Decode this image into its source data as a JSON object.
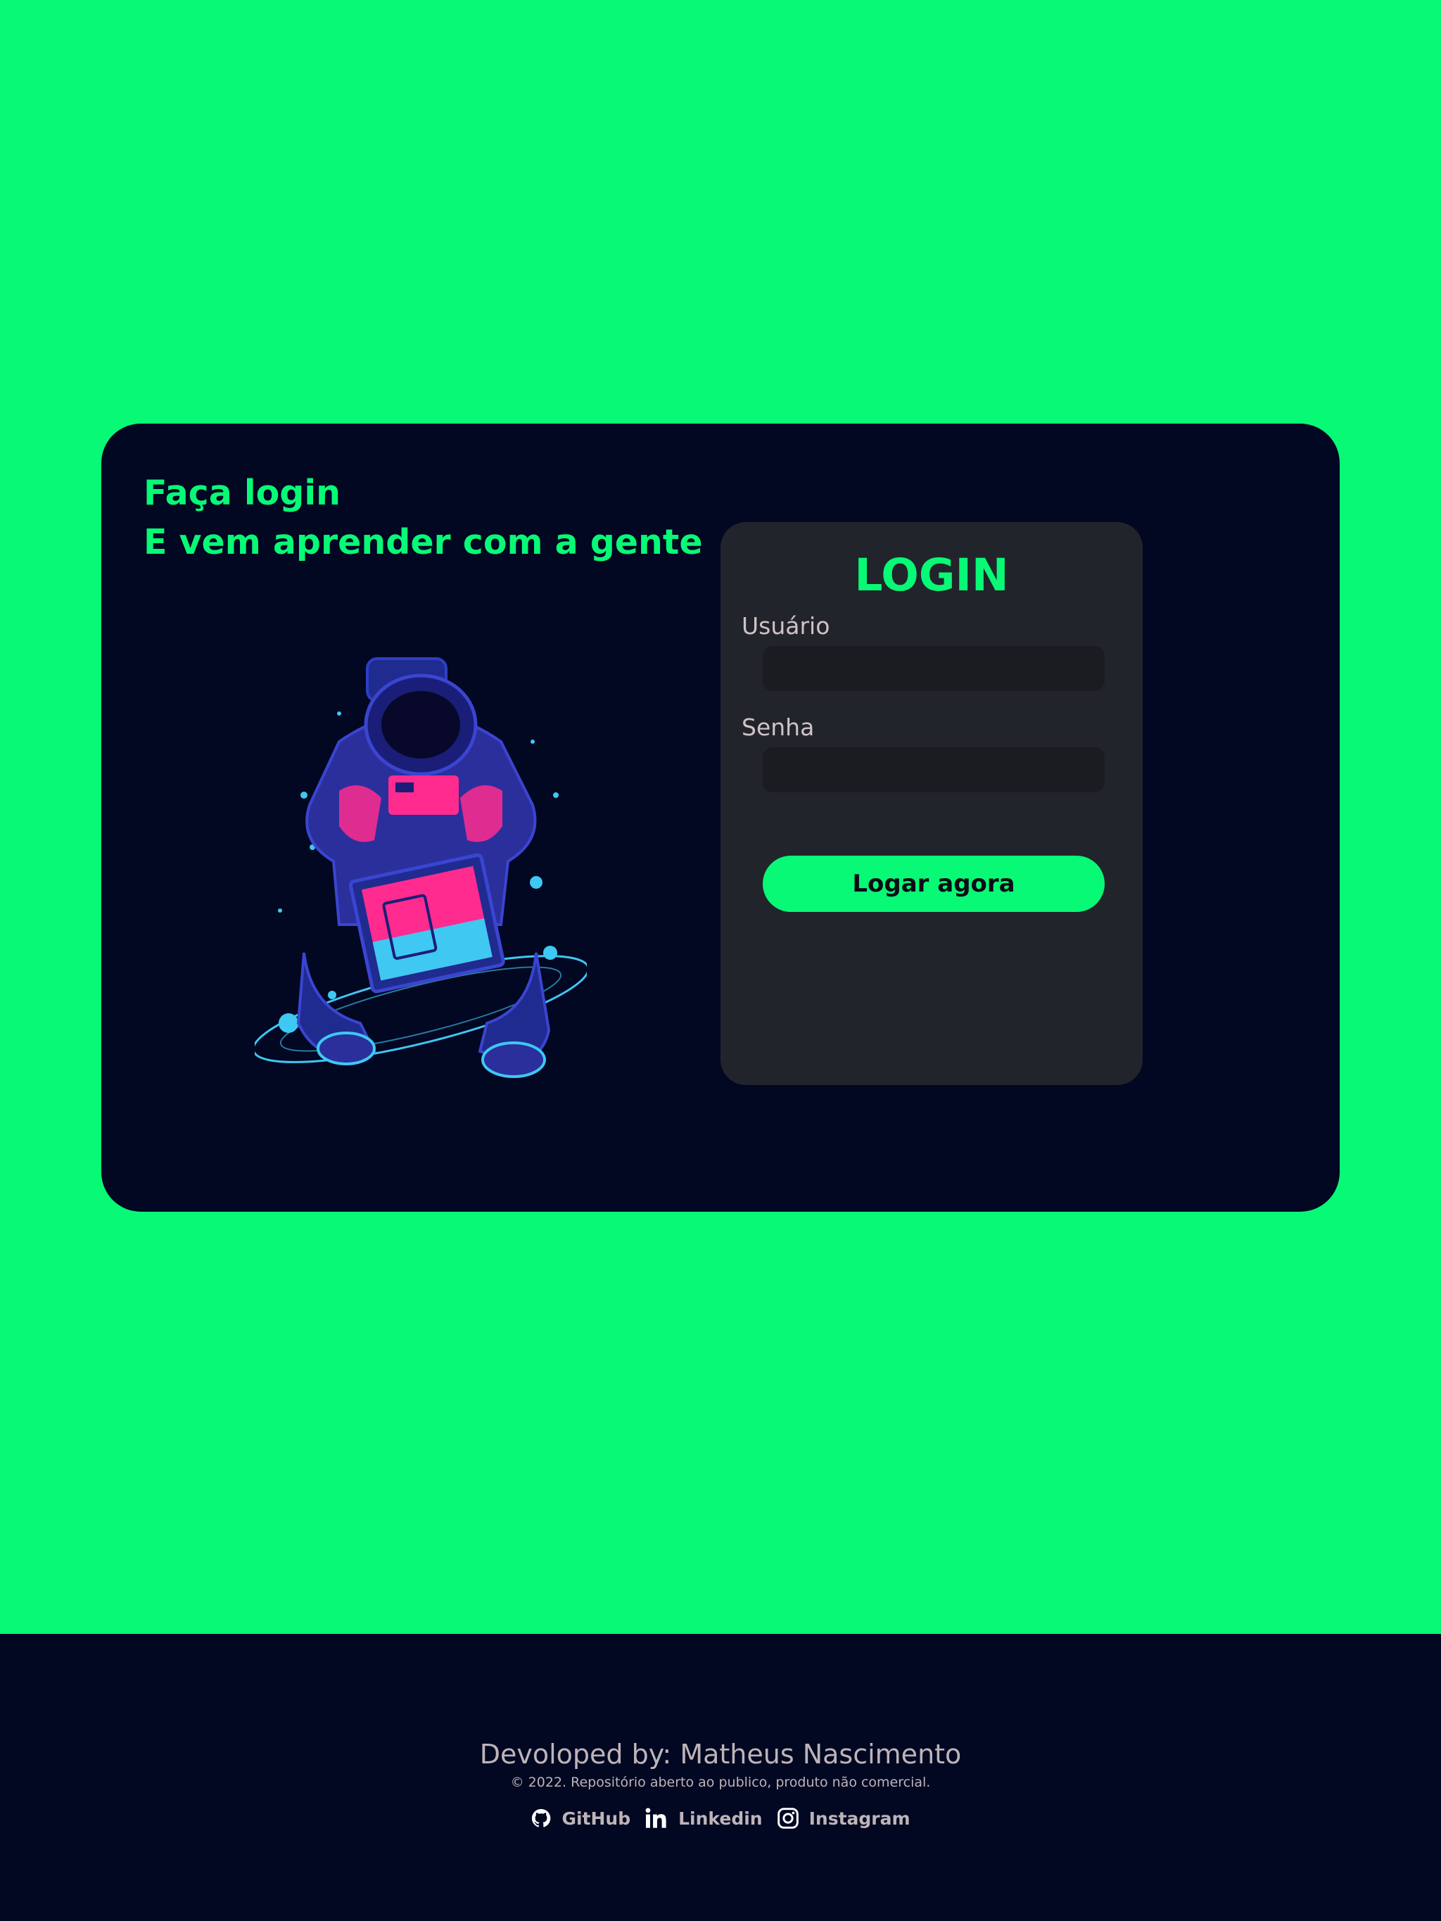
{
  "hero": {
    "line1": "Faça login",
    "line2": "E vem aprender com a gente",
    "illustration": "astronaut-with-tablet"
  },
  "login": {
    "title": "LOGIN",
    "username_label": "Usuário",
    "username_value": "",
    "password_label": "Senha",
    "password_value": "",
    "submit_label": "Logar agora"
  },
  "footer": {
    "developer": "Devoloped by: Matheus Nascimento",
    "copyright": "© 2022. Repositório aberto ao publico, produto não comercial.",
    "links": [
      {
        "label": "GitHub",
        "icon": "github-icon"
      },
      {
        "label": "Linkedin",
        "icon": "linkedin-icon"
      },
      {
        "label": "Instagram",
        "icon": "instagram-icon"
      }
    ]
  },
  "colors": {
    "accent": "#07f976",
    "card_background": "#020722",
    "panel_background": "#22242b",
    "input_background": "#1a1c22",
    "muted_text": "#cfc3c6"
  }
}
